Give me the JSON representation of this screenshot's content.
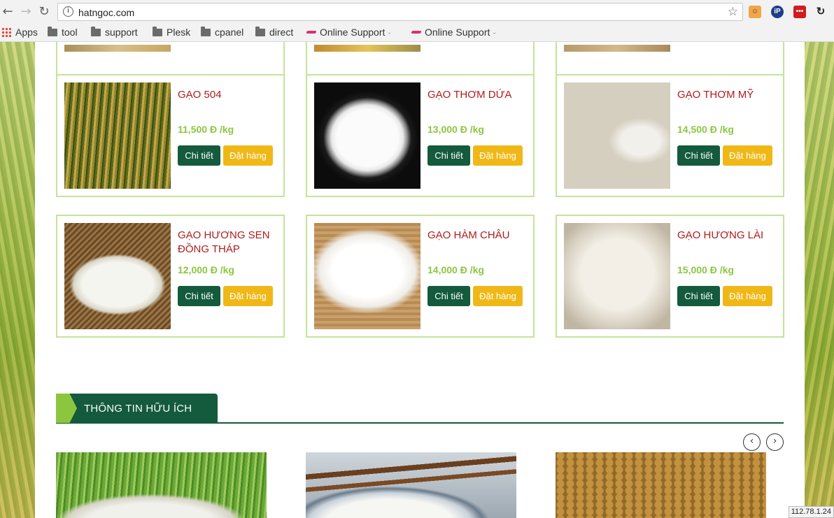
{
  "browser": {
    "url": "hatngoc.com",
    "bookmarks": [
      {
        "label": "Apps",
        "type": "apps"
      },
      {
        "label": "tool",
        "type": "folder"
      },
      {
        "label": "support",
        "type": "folder"
      },
      {
        "label": "Plesk",
        "type": "folder"
      },
      {
        "label": "cpanel",
        "type": "folder"
      },
      {
        "label": "direct",
        "type": "folder"
      },
      {
        "label": "Online Support",
        "type": "link"
      },
      {
        "label": "Online Support",
        "type": "link"
      }
    ],
    "ip_badge": "112.78.1.24"
  },
  "products": [
    {
      "name": "GẠO 504",
      "price": "11,500 Đ /kg",
      "detail_label": "Chi tiết",
      "order_label": "Đặt hàng"
    },
    {
      "name": "GẠO THƠM DỨA",
      "price": "13,000 Đ /kg",
      "detail_label": "Chi tiết",
      "order_label": "Đặt hàng"
    },
    {
      "name": "GẠO THƠM MỸ",
      "price": "14,500 Đ /kg",
      "detail_label": "Chi tiết",
      "order_label": "Đặt hàng"
    },
    {
      "name": "GẠO HƯƠNG SEN ĐỒNG THÁP",
      "price": "12,000 Đ /kg",
      "detail_label": "Chi tiết",
      "order_label": "Đặt hàng"
    },
    {
      "name": "GẠO HÀM CHÂU",
      "price": "14,000 Đ /kg",
      "detail_label": "Chi tiết",
      "order_label": "Đặt hàng"
    },
    {
      "name": "GẠO HƯƠNG LÀI",
      "price": "15,000 Đ /kg",
      "detail_label": "Chi tiết",
      "order_label": "Đặt hàng"
    }
  ],
  "info_section": {
    "title": "THÔNG TIN HỮU ÍCH",
    "prev_icon": "chevron-left-icon",
    "next_icon": "chevron-right-icon"
  },
  "colors": {
    "primary_green": "#145a3c",
    "accent_green": "#8cc63f",
    "order_yellow": "#f0b816",
    "product_name_red": "#b01c1c",
    "card_border": "#c3e49a"
  }
}
